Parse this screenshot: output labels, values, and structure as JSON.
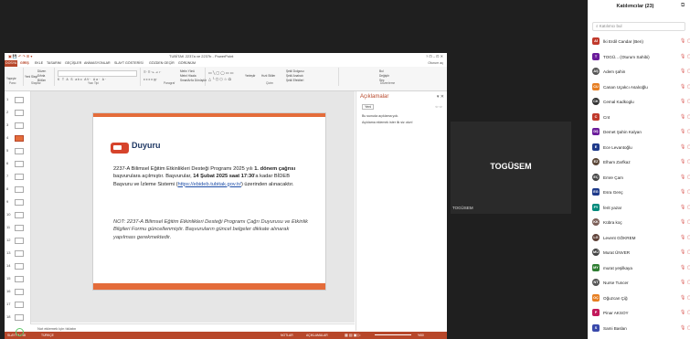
{
  "app": {
    "window_title": "TUBİTAK 2237a ve 2237b - PowerPoint",
    "window_controls": "?  ⊡  –  ⊡  ✕",
    "account": "Oturum aç"
  },
  "ribbon": {
    "tabs": [
      "DOSYA",
      "GİRİŞ",
      "EKLE",
      "TASARIM",
      "GEÇİŞLER",
      "ANİMASYONLAR",
      "SLAYT GÖSTERİSİ",
      "GÖZDEN GEÇİR",
      "GÖRÜNÜM"
    ],
    "groups": [
      "Pano",
      "Slaytlar",
      "Yazı Tipi",
      "Paragraf",
      "Çizim",
      "Düzenleme"
    ],
    "buttons": [
      "Yapıştır",
      "Yeni Slayt",
      "Düzen",
      "Sıfırla",
      "Bölüm",
      "Metin Yönü",
      "Metni Hizala",
      "SmartArt'a Dönüştür",
      "Şekil Dolgusu",
      "Şekil Anahatı",
      "Şekil Efektleri",
      "Bul",
      "Değiştir",
      "Seç",
      "Hızlı Stiller",
      "Yerleştir"
    ]
  },
  "thumbnails": [
    "1",
    "2",
    "3",
    "4",
    "5",
    "6",
    "7",
    "8",
    "9",
    "10",
    "11",
    "12",
    "13",
    "14",
    "15",
    "16",
    "17",
    "18"
  ],
  "slide": {
    "heading": "Duyuru",
    "p1_a": "2237-A Bilimsel Eğitim Etkinlikleri Desteği Programı 2025 yılı ",
    "p1_b": "1. dönem çağrısı",
    "p1_c": " başvurulara açılmıştır. Başvurular, ",
    "p1_d": "14 Şubat 2025 saat 17:30",
    "p1_e": "'a kadar BİDEB Başvuru ve İzleme Sistemi (",
    "p1_f": "https://ebideb.tubitak.gov.tr/",
    "p1_g": ") üzerinden alınacaktır.",
    "p2": "NOT: 2237-A Bilimsel Eğitim Etkinlikleri Desteği Programı Çağrı Duyurusu ve Etkinlik Bilgileri Formu güncellenmiştir. Başvuruların güncel belgeler dikkate alınarak yapılması gerekmektedir."
  },
  "notes": {
    "placeholder": "Not eklemek için tıklatın"
  },
  "comments_pane": {
    "title": "Açıklamalar",
    "new_button": "Yeni",
    "line1": "Bu sunuda açıklama yok.",
    "line2": "Açıklama eklemek ister ilk siz olun!"
  },
  "statusbar": {
    "left": "SLAYT 4 / 18",
    "language": "TÜRKÇE",
    "notes": "NOTLAR",
    "comments": "AÇIKLAMALAR",
    "zoom": "%50"
  },
  "tile": {
    "name": "TOGÜSEM",
    "label": "TOGÜSEM"
  },
  "participants": {
    "title": "Katılımcılar (23)",
    "search_placeholder": "Katılımcı bul",
    "list": [
      {
        "initials": "Aİ",
        "name": "İki Erdil Candar (Ben)",
        "color": "#c0392b",
        "photo": false
      },
      {
        "initials": "T",
        "name": "TOGÜ... (Oturum Sahibi)",
        "color": "#6a1b9a",
        "photo": false
      },
      {
        "initials": "AŞ",
        "name": "Adem şahin",
        "color": "#555555",
        "photo": true
      },
      {
        "initials": "CU",
        "name": "Canan Uçakcı Asalıoğlu",
        "color": "#e67e22",
        "photo": false
      },
      {
        "initials": "CK",
        "name": "Cemal Kadkoglu",
        "color": "#333333",
        "photo": true
      },
      {
        "initials": "C",
        "name": "Cnt",
        "color": "#c0392b",
        "photo": false
      },
      {
        "initials": "DŞ",
        "name": "Demet Şahin Kalyan",
        "color": "#6a1b9a",
        "photo": false
      },
      {
        "initials": "E",
        "name": "Ece Levantoğlu",
        "color": "#1e3a8a",
        "photo": false
      },
      {
        "initials": "EZ",
        "name": "Elham Zarfkaz",
        "color": "#5a4636",
        "photo": true
      },
      {
        "initials": "EÇ",
        "name": "Emre Çam",
        "color": "#444444",
        "photo": true
      },
      {
        "initials": "EG",
        "name": "Esra Genç",
        "color": "#1e3a8a",
        "photo": false
      },
      {
        "initials": "FY",
        "name": "ferit yazar",
        "color": "#00897b",
        "photo": false
      },
      {
        "initials": "KK",
        "name": "Kübra koç",
        "color": "#7b5e57",
        "photo": true
      },
      {
        "initials": "LG",
        "name": "Levent GÖKREM",
        "color": "#5d4037",
        "photo": true
      },
      {
        "initials": "MÜ",
        "name": "Murat ÜNVER",
        "color": "#444444",
        "photo": true
      },
      {
        "initials": "MY",
        "name": "murat yeşilkaya",
        "color": "#2e7d32",
        "photo": false
      },
      {
        "initials": "NT",
        "name": "Nurse Tuncer",
        "color": "#555555",
        "photo": true
      },
      {
        "initials": "OÇ",
        "name": "Oğuzcan Çiğ",
        "color": "#e67e22",
        "photo": false
      },
      {
        "initials": "P",
        "name": "Pinar AKSOY",
        "color": "#c2185b",
        "photo": false
      },
      {
        "initials": "S",
        "name": "Sami Baslan",
        "color": "#3949ab",
        "photo": false
      }
    ]
  }
}
